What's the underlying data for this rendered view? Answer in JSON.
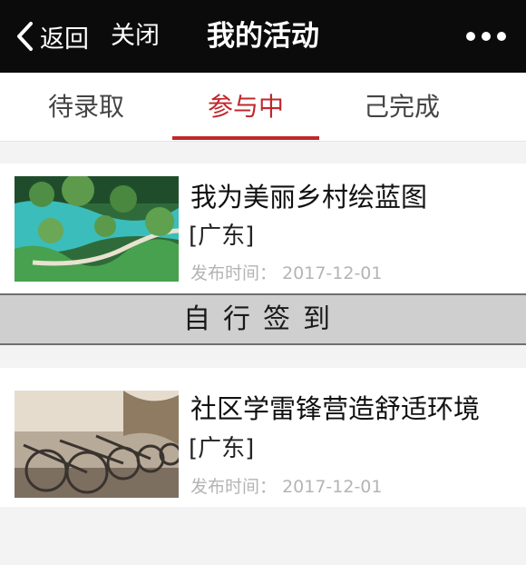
{
  "nav": {
    "back_label": "返回",
    "close_label": "关闭",
    "title": "我的活动"
  },
  "tabs": [
    {
      "label": "待录取",
      "active": false
    },
    {
      "label": "参与中",
      "active": true
    },
    {
      "label": "己完成",
      "active": false
    }
  ],
  "activities": [
    {
      "title": "我为美丽乡村绘蓝图",
      "region": "[广东]",
      "date_label": "发布时间：",
      "date": "2017-12-01",
      "action_label": "自行签到"
    },
    {
      "title": "社区学雷锋营造舒适环境",
      "region": "[广东]",
      "date_label": "发布时间：",
      "date": "2017-12-01"
    }
  ],
  "colors": {
    "accent": "#c0272d",
    "navbar": "#0b0b0b",
    "signin_bg": "#cfcfcf"
  }
}
